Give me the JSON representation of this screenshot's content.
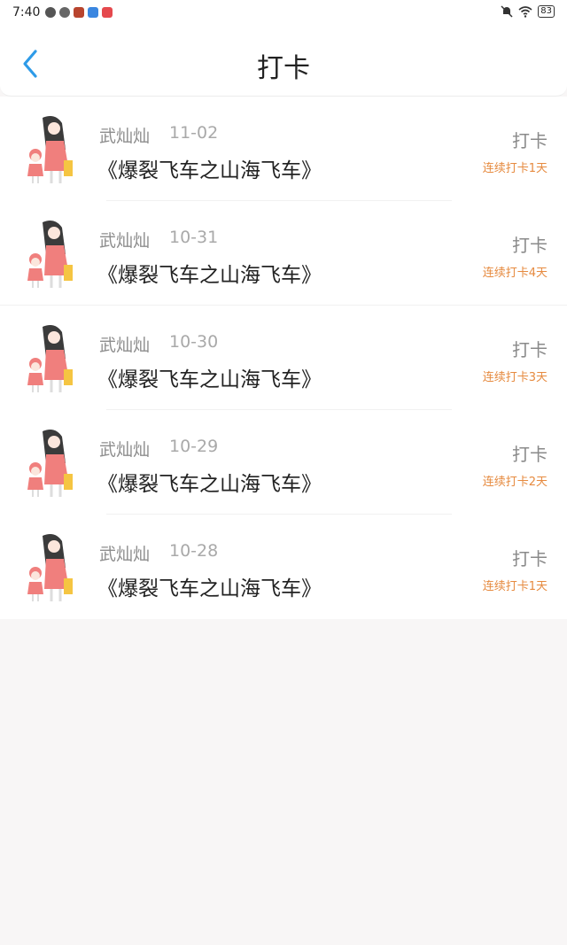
{
  "status_bar": {
    "time": "7:40",
    "battery": "83"
  },
  "header": {
    "title": "打卡"
  },
  "items": [
    {
      "name": "武灿灿",
      "date": "11-02",
      "book": "《爆裂飞车之山海飞车》",
      "action": "打卡",
      "streak": "连续打卡1天"
    },
    {
      "name": "武灿灿",
      "date": "10-31",
      "book": "《爆裂飞车之山海飞车》",
      "action": "打卡",
      "streak": "连续打卡4天"
    },
    {
      "name": "武灿灿",
      "date": "10-30",
      "book": "《爆裂飞车之山海飞车》",
      "action": "打卡",
      "streak": "连续打卡3天"
    },
    {
      "name": "武灿灿",
      "date": "10-29",
      "book": "《爆裂飞车之山海飞车》",
      "action": "打卡",
      "streak": "连续打卡2天"
    },
    {
      "name": "武灿灿",
      "date": "10-28",
      "book": "《爆裂飞车之山海飞车》",
      "action": "打卡",
      "streak": "连续打卡1天"
    }
  ],
  "colors": {
    "accent": "#2e9be8",
    "streak": "#e68a3f"
  }
}
